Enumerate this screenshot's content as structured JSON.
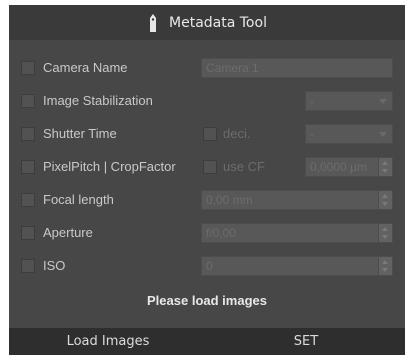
{
  "title": "Metadata Tool",
  "rows": {
    "camera_name": {
      "label": "Camera Name",
      "value": "Camera 1"
    },
    "image_stabilization": {
      "label": "Image Stabilization",
      "value": "-"
    },
    "shutter_time": {
      "label": "Shutter Time",
      "decimal_label": "deci.",
      "value": "-"
    },
    "pixel_pitch": {
      "label": "PixelPitch | CropFactor",
      "use_cf_label": "use CF",
      "value": "0,0000 µm"
    },
    "focal_length": {
      "label": "Focal length",
      "value": "0,00 mm"
    },
    "aperture": {
      "label": "Aperture",
      "value": "f/0,00"
    },
    "iso": {
      "label": "ISO",
      "value": "0"
    }
  },
  "status": "Please load images",
  "buttons": {
    "load": "Load Images",
    "set": "SET"
  }
}
